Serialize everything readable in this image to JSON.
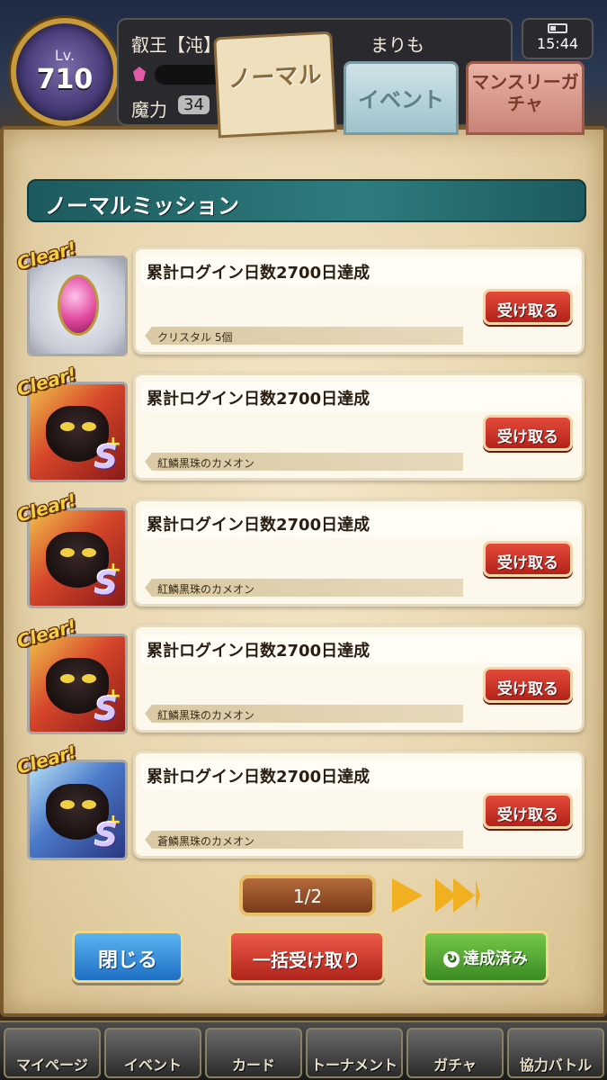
{
  "header": {
    "level_label": "Lv.",
    "level": "710",
    "player_name": "叡王【沌】",
    "user_name": "まりも",
    "power_label": "魔力",
    "power_value": "34",
    "time": "15:44"
  },
  "tabs": [
    {
      "label": "ノーマル"
    },
    {
      "label": "イベント"
    },
    {
      "label": "マンスリーガチャ"
    }
  ],
  "panel_title": "ノーマルミッション",
  "clear_text": "Clear!",
  "receive_label": "受け取る",
  "missions": [
    {
      "title": "累計ログイン日数2700日達成",
      "reward": "クリスタル 5個"
    },
    {
      "title": "累計ログイン日数2700日達成",
      "reward": "紅鱗黒珠のカメオン",
      "rank": "S"
    },
    {
      "title": "累計ログイン日数2700日達成",
      "reward": "紅鱗黒珠のカメオン",
      "rank": "S"
    },
    {
      "title": "累計ログイン日数2700日達成",
      "reward": "紅鱗黒珠のカメオン",
      "rank": "S"
    },
    {
      "title": "累計ログイン日数2700日達成",
      "reward": "蒼鱗黒珠のカメオン",
      "rank": "S"
    }
  ],
  "pagination": {
    "page": "1/2"
  },
  "buttons": {
    "close": "閉じる",
    "bulk_receive": "一括受け取り",
    "achieved": "達成済み"
  },
  "bottom_nav": [
    {
      "label": "マイページ"
    },
    {
      "label": "イベント"
    },
    {
      "label": "カード"
    },
    {
      "label": "トーナメント"
    },
    {
      "label": "ガチャ"
    },
    {
      "label": "協力バトル"
    }
  ],
  "colors": {
    "panel_title_bg": "#2e7c7e",
    "receive_button": "#c9302a",
    "close_button": "#2e84d4",
    "bulk_button": "#c9302a",
    "achieved_button": "#52a632"
  }
}
